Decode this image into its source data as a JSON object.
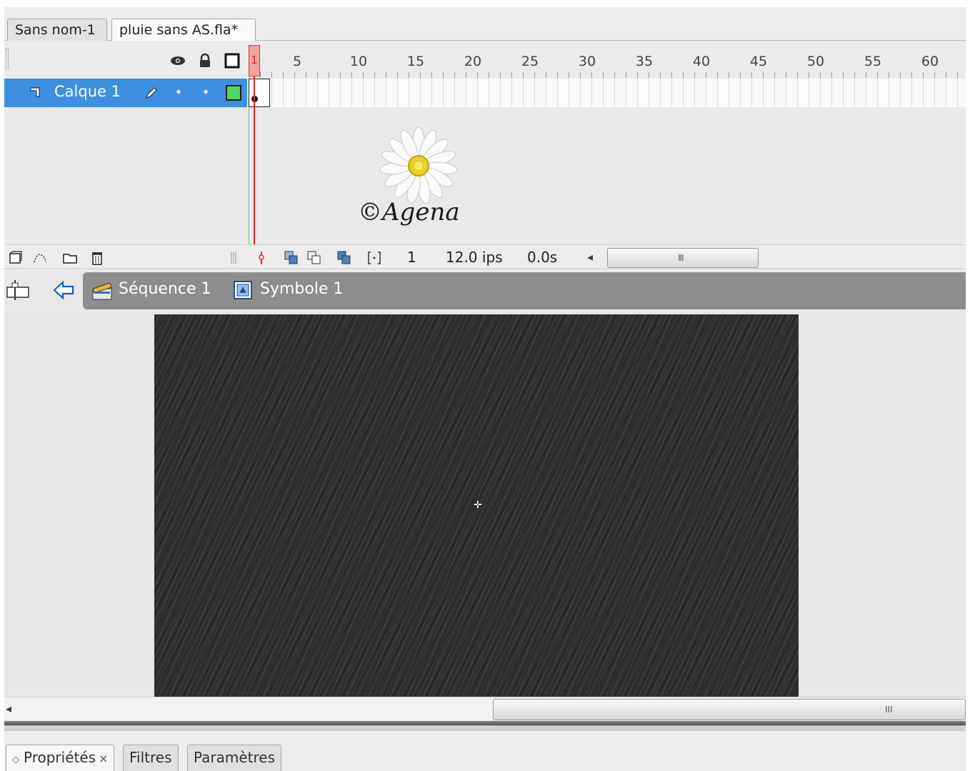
{
  "document_tabs": [
    "Sans nom-1",
    "pluie sans AS.fla*"
  ],
  "timeline": {
    "header_icons": [
      "eye-icon",
      "lock-icon",
      "outline-icon"
    ],
    "ruler_numbers": [
      "5",
      "10",
      "15",
      "20",
      "25",
      "30",
      "35",
      "40",
      "45",
      "50",
      "55",
      "60"
    ],
    "current_frame_marker": "1",
    "layer": {
      "name": "Calque 1",
      "outline_color": "#4bdc5c"
    },
    "footer": {
      "current_frame": "1",
      "frame_rate": "12.0 ips",
      "elapsed_time": "0.0s"
    }
  },
  "watermark": {
    "text": "©Agena"
  },
  "breadcrumb": {
    "items": [
      {
        "label": "Séquence 1",
        "icon": "scene-clapper-icon"
      },
      {
        "label": "Symbole 1",
        "icon": "movieclip-symbol-icon"
      }
    ]
  },
  "stage": {
    "background": "#2d2d2d",
    "content": "rain"
  },
  "panel_tabs": [
    "Propriétés",
    "Filtres",
    "Paramètres"
  ],
  "colors": {
    "selected_layer": "#3d8fe0",
    "playhead": "#e22222",
    "editbar": "#8d8d8d"
  }
}
